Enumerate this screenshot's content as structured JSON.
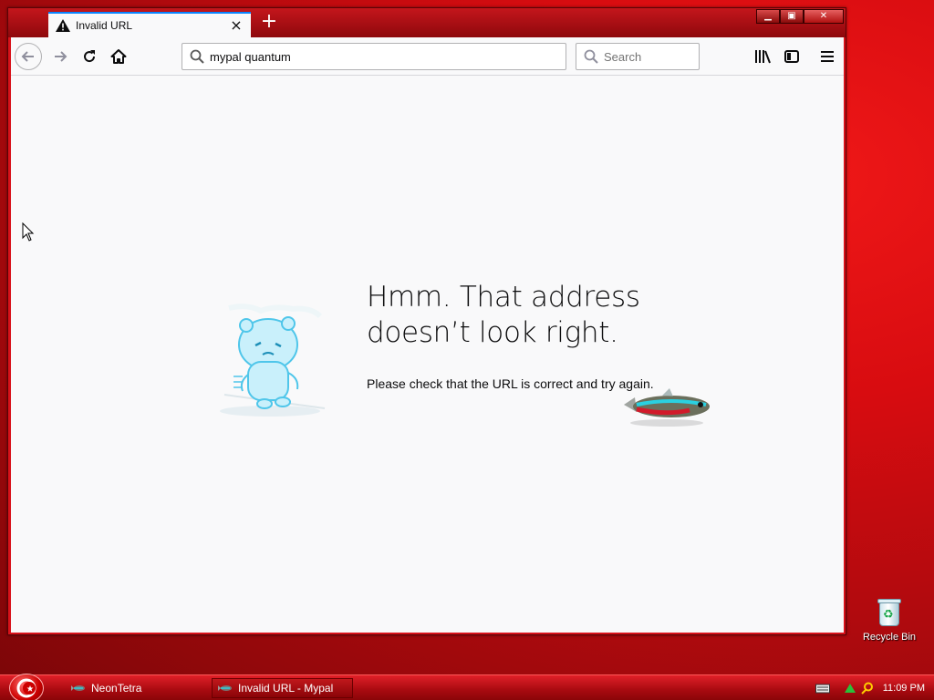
{
  "window": {
    "tab_title": "Invalid URL",
    "new_tab_symbol": "+",
    "close_tab_symbol": "×"
  },
  "navbar": {
    "url_value": "mypal quantum",
    "search_placeholder": "Search"
  },
  "error": {
    "title": "Hmm. That address doesn’t look right.",
    "description": "Please check that the URL is correct and try again."
  },
  "desktop": {
    "recycle_bin_label": "Recycle Bin"
  },
  "taskbar": {
    "items": [
      {
        "label": "NeonTetra"
      },
      {
        "label": "Invalid URL - Mypal"
      }
    ],
    "clock": "11:09 PM"
  },
  "colors": {
    "desktop_red": "#d80c10",
    "tab_accent": "#0a84ff",
    "content_bg": "#f9f9fa"
  }
}
